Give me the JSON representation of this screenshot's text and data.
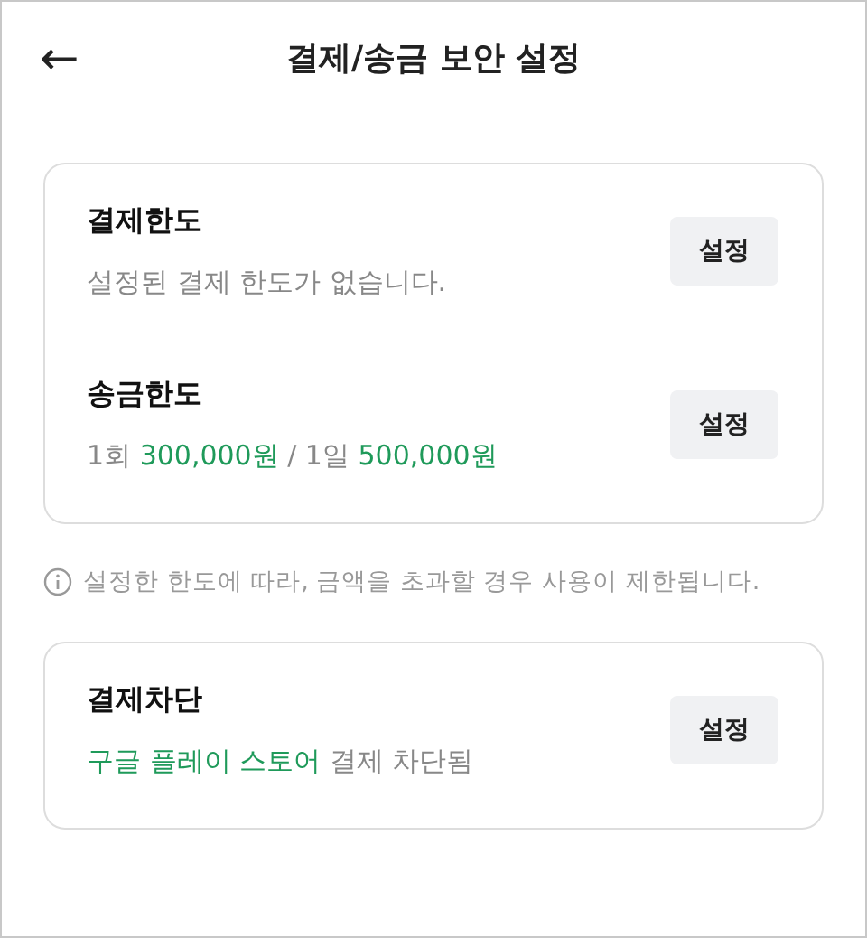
{
  "header": {
    "back": "←",
    "title": "결제/송금 보안 설정"
  },
  "cards": [
    {
      "items": [
        {
          "title": "결제한도",
          "button": "설정",
          "description": [
            {
              "text": "설정된 결제 한도가 없습니다.",
              "highlight": false
            }
          ]
        },
        {
          "title": "송금한도",
          "button": "설정",
          "description": [
            {
              "text": "1회 ",
              "highlight": false
            },
            {
              "text": "300,000원",
              "highlight": true
            },
            {
              "text": " / 1일 ",
              "highlight": false
            },
            {
              "text": "500,000원",
              "highlight": true
            }
          ]
        }
      ],
      "note": "설정한 한도에 따라, 금액을 초과할 경우 사용이 제한됩니다."
    },
    {
      "items": [
        {
          "title": "결제차단",
          "button": "설정",
          "description": [
            {
              "text": "구글 플레이 스토어",
              "highlight": true
            },
            {
              "text": " 결제 차단됨",
              "highlight": false
            }
          ]
        }
      ]
    }
  ]
}
